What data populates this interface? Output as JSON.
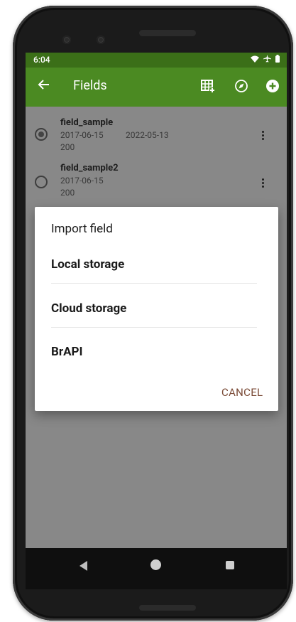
{
  "status": {
    "time": "6:04"
  },
  "appbar": {
    "title": "Fields"
  },
  "fields": [
    {
      "name": "field_sample",
      "date1": "2017-06-15",
      "date2": "2022-05-13",
      "count": "200",
      "selected": true
    },
    {
      "name": "field_sample2",
      "date1": "2017-06-15",
      "date2": "",
      "count": "200",
      "selected": false
    }
  ],
  "dialog": {
    "title": "Import field",
    "options": [
      "Local storage",
      "Cloud storage",
      "BrAPI"
    ],
    "cancel": "CANCEL"
  },
  "colors": {
    "statusbar": "#3b6f18",
    "appbar": "#4b8a22",
    "accent": "#7a4a36"
  },
  "icons": [
    "back-arrow-icon",
    "table-add-icon",
    "compass-icon",
    "add-circle-icon",
    "wifi-icon",
    "airplane-icon",
    "battery-icon",
    "more-vert-icon"
  ]
}
